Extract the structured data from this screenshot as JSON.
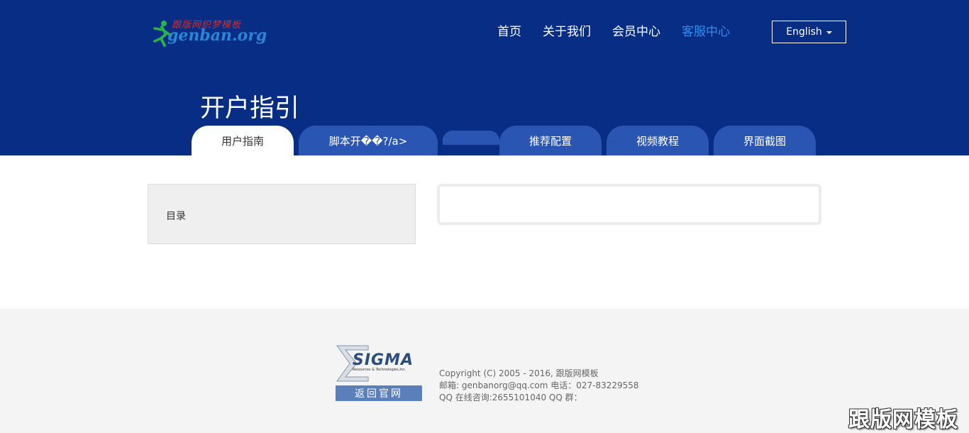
{
  "logo": {
    "cn_text": "跟版网织梦模板",
    "en_text": "genban.org",
    "icon": "runner-icon"
  },
  "nav": {
    "items": [
      {
        "label": "首页",
        "active": false
      },
      {
        "label": "关于我们",
        "active": false
      },
      {
        "label": "会员中心",
        "active": false
      },
      {
        "label": "客服中心",
        "active": true
      }
    ],
    "language_button": "English"
  },
  "page": {
    "title": "开户指引"
  },
  "tabs": [
    {
      "label": "用户指南",
      "active": true
    },
    {
      "label": "脚本开��?/a>",
      "active": false
    },
    {
      "label": "",
      "active": false
    },
    {
      "label": "推荐配置",
      "active": false
    },
    {
      "label": "视频教程",
      "active": false
    },
    {
      "label": "界面截图",
      "active": false
    }
  ],
  "sidebar": {
    "toc_label": "目录"
  },
  "footer": {
    "sigma_word": "SIGMA",
    "sigma_sub": "Resources & Technologies,Inc.",
    "back_button": "返回官网",
    "copyright": "Copyright (C) 2005 - 2016, 跟版网模板",
    "contact": "邮箱: genbanorg@qq.com 电话：027-83229558",
    "qq": "QQ 在线咨询:2655101040 QQ 群："
  },
  "watermark": "跟版网模板",
  "colors": {
    "header_bg": "#072d84",
    "tab_bg": "#2a55b3",
    "nav_active": "#2f8ff0",
    "footer_bg": "#f4f4f4"
  }
}
